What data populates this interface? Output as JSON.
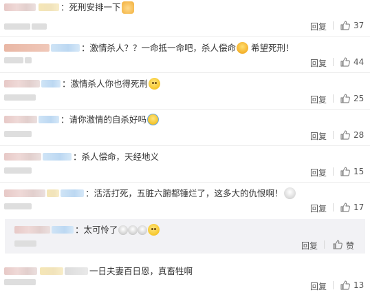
{
  "comments": [
    {
      "text": "死刑安排一下",
      "emoji": "hand",
      "reply_label": "回复",
      "likes": "37"
    },
    {
      "text": "激情杀人？？一命抵一命吧，杀人偿命",
      "emoji": "angry",
      "text_after": "希望死刑！",
      "reply_label": "回复",
      "likes": "44"
    },
    {
      "text": "激情杀人你也得死刑",
      "emoji": "yellow",
      "reply_label": "回复",
      "likes": "25"
    },
    {
      "text": "请你激情的自杀好吗",
      "emoji": "cry",
      "reply_label": "回复",
      "likes": "28"
    },
    {
      "text": "杀人偿命，天经地义",
      "reply_label": "回复",
      "likes": "15"
    },
    {
      "text": "活活打死，五脏六腑都锤烂了，这多大的仇恨啊！",
      "emoji": "skull",
      "reply_label": "回复",
      "likes": "17"
    },
    {
      "text": "太可怜了",
      "emoji": "yellow",
      "reply_label": "回复",
      "likes": "赞"
    },
    {
      "text": "一日夫妻百日恩，真畜牲啊",
      "reply_label": "回复",
      "likes": "13"
    }
  ],
  "icons": {
    "like": "thumbs-up-icon"
  },
  "colors": {
    "text": "#333333",
    "muted": "#777777",
    "reply_bg": "#f2f2f5",
    "divider": "#ececec"
  }
}
